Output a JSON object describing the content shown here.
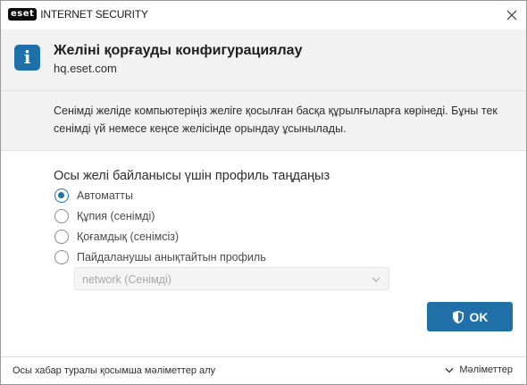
{
  "window": {
    "logo_text": "eset",
    "product_name": "INTERNET SECURITY"
  },
  "header": {
    "title": "Желіні қорғауды конфигурациялау",
    "subtitle": "hq.eset.com"
  },
  "description": "Сенімді желіде компьютеріңіз желіге қосылған басқа құрылғыларға көрінеді. Бұны тек сенімді үй немесе кеңсе желісінде орындау ұсынылады.",
  "profile": {
    "heading": "Осы желі байланысы үшін профиль таңдаңыз",
    "options": [
      {
        "label": "Автоматты",
        "checked": true
      },
      {
        "label": "Құпия (сенімді)",
        "checked": false
      },
      {
        "label": "Қоғамдық (сенімсіз)",
        "checked": false
      },
      {
        "label": "Пайдаланушы анықтайтын профиль",
        "checked": false
      }
    ],
    "custom_select": {
      "value": "network (Сенімді)",
      "disabled": true
    }
  },
  "buttons": {
    "ok_label": "OK"
  },
  "footer": {
    "more_info_link": "Осы хабар туралы қосымша мәліметтер алу",
    "details_label": "Мәліметтер"
  },
  "colors": {
    "accent": "#1f70a9",
    "header_bg": "#f2f2f2",
    "logo_bg": "#0a0a0a"
  },
  "icons": {
    "info": "info-icon",
    "close": "close-icon",
    "shield": "shield-icon",
    "chevron": "chevron-down-icon"
  }
}
